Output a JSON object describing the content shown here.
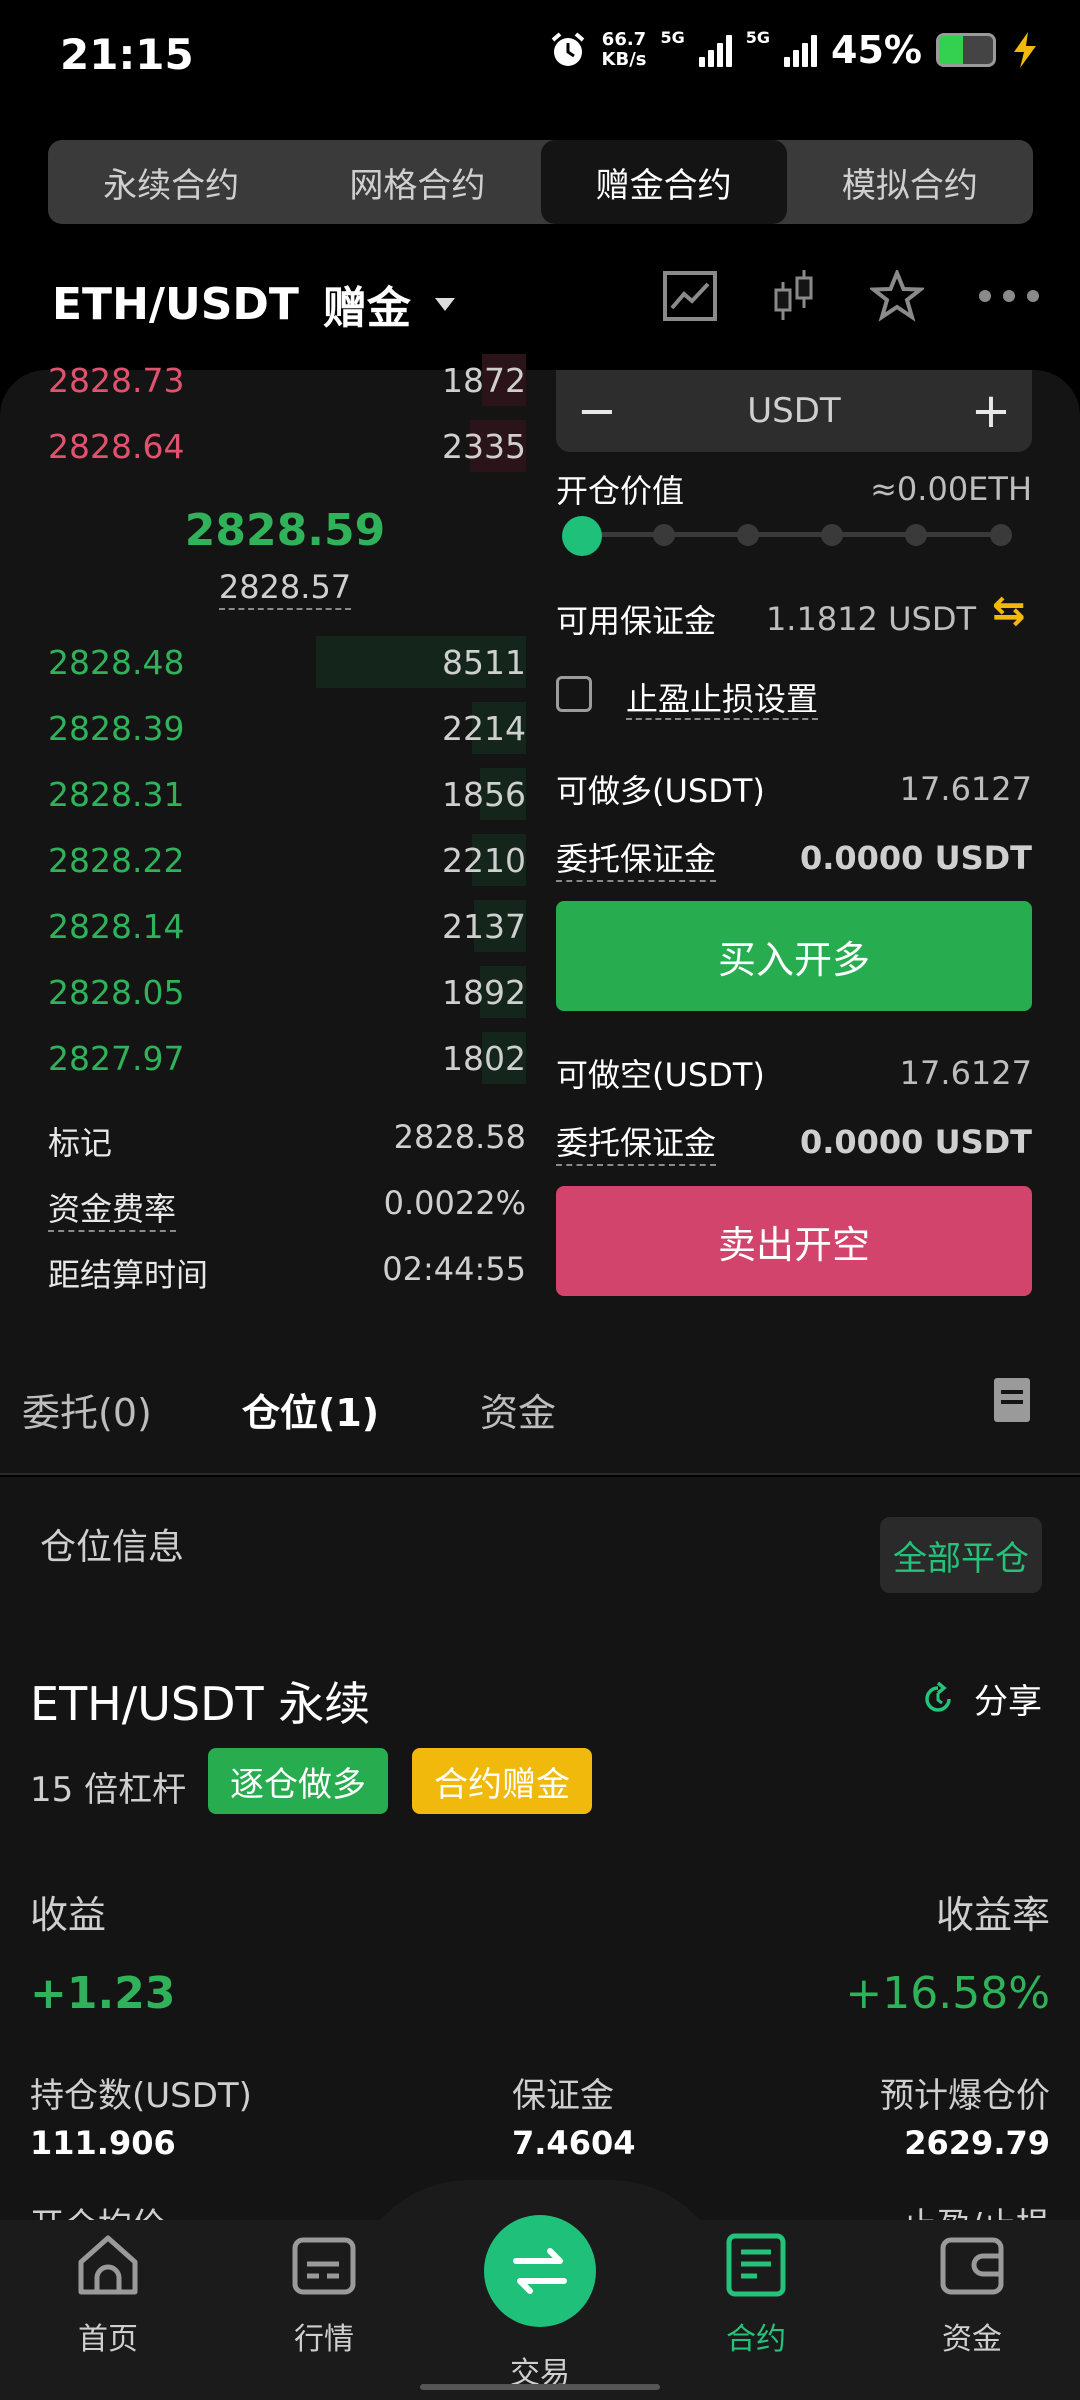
{
  "status_bar": {
    "time": "21:15",
    "net_speed_value": "66.7",
    "net_speed_unit": "KB/s",
    "signal1_label": "5G",
    "signal2_label": "5G",
    "battery_percent": "45%",
    "battery_level": 0.45
  },
  "contract_tabs": [
    "永续合约",
    "网格合约",
    "赠金合约",
    "模拟合约"
  ],
  "active_tab": "赠金合约",
  "pair": {
    "symbol": "ETH/USDT",
    "type": "赠金"
  },
  "order_book": {
    "asks": [
      {
        "price": "2828.73",
        "qty": "1872"
      },
      {
        "price": "2828.64",
        "qty": "2335"
      }
    ],
    "last_price": "2828.59",
    "mark_price_below": "2828.57",
    "bids": [
      {
        "price": "2828.48",
        "qty": "8511"
      },
      {
        "price": "2828.39",
        "qty": "2214"
      },
      {
        "price": "2828.31",
        "qty": "1856"
      },
      {
        "price": "2828.22",
        "qty": "2210"
      },
      {
        "price": "2828.14",
        "qty": "2137"
      },
      {
        "price": "2828.05",
        "qty": "1892"
      },
      {
        "price": "2827.97",
        "qty": "1802"
      }
    ],
    "info": [
      {
        "label": "标记",
        "value": "2828.58"
      },
      {
        "label": "资金费率",
        "value": "0.0022%"
      },
      {
        "label": "距结算时间",
        "value": "02:44:55"
      }
    ]
  },
  "order_form": {
    "minus": "−",
    "plus": "+",
    "unit": "USDT",
    "open_value_label": "开仓价值",
    "open_value": "≈0.00ETH",
    "slider_level": 0,
    "available_margin_label": "可用保证金",
    "available_margin": "1.1812 USDT",
    "swap_icon": "⇆",
    "tpsl_label": "止盈止损设置",
    "can_long_label": "可做多(USDT)",
    "can_long": "17.6127",
    "order_margin_label": "委托保证金",
    "order_margin_long": "0.0000 USDT",
    "buy_button": "买入开多",
    "can_short_label": "可做空(USDT)",
    "can_short": "17.6127",
    "order_margin_short": "0.0000 USDT",
    "sell_button": "卖出开空"
  },
  "sub_tabs": [
    "委托(0)",
    "仓位(1)",
    "资金"
  ],
  "position": {
    "section_title": "仓位信息",
    "close_all": "全部平仓",
    "symbol": "ETH/USDT 永续",
    "share": "分享",
    "leverage": "15 倍杠杆",
    "badge_mode": "逐仓做多",
    "badge_bonus": "合约赠金",
    "pnl_label": "收益",
    "pnl_value": "+1.23",
    "roi_label": "收益率",
    "roi_value": "+16.58%",
    "size_label": "持仓数(USDT)",
    "size_value": "111.906",
    "margin_label": "保证金",
    "margin_value": "7.4604",
    "liq_label": "预计爆仓价",
    "liq_value": "2629.79",
    "entry_label": "开仓均价",
    "tpsl_label": "止盈/止损"
  },
  "colors": {
    "accent": "#1fc07a",
    "buy": "#27ad4f",
    "sell": "#d2446b",
    "bonus": "#f0b90b"
  },
  "bottom_nav": [
    {
      "label": "首页",
      "icon": "home-icon"
    },
    {
      "label": "行情",
      "icon": "market-icon"
    },
    {
      "label": "交易",
      "icon": "trade-icon"
    },
    {
      "label": "合约",
      "icon": "contract-icon"
    },
    {
      "label": "资金",
      "icon": "wallet-icon"
    }
  ],
  "active_nav": "合约"
}
